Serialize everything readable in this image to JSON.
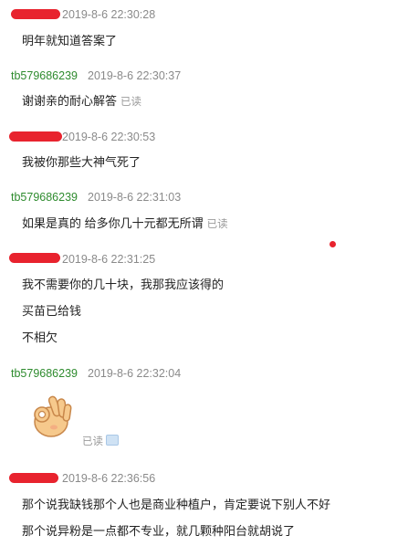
{
  "colors": {
    "nickname_seller": "#2e8b2e",
    "timestamp": "#8a8a8a",
    "redaction": "#e8232e",
    "read_status": "#9a9a9a"
  },
  "messages": [
    {
      "sender": "",
      "time": "2019-8-6 22:30:28",
      "lines": [
        "明年就知道答案了"
      ]
    },
    {
      "sender": "tb579686239",
      "time": "2019-8-6 22:30:37",
      "lines": [
        "谢谢亲的耐心解答"
      ],
      "status": "已读"
    },
    {
      "sender": "",
      "time": "2019-8-6 22:30:53",
      "lines": [
        "我被你那些大神气死了"
      ]
    },
    {
      "sender": "tb579686239",
      "time": "2019-8-6 22:31:03",
      "lines": [
        "如果是真的 给多你几十元都无所谓"
      ],
      "status": "已读"
    },
    {
      "sender": "",
      "time": "2019-8-6 22:31:25",
      "lines": [
        "我不需要你的几十块，我那我应该得的",
        "买苗已给钱",
        "不相欠"
      ]
    },
    {
      "sender": "tb579686239",
      "time": "2019-8-6 22:32:04",
      "sticker": "ok-hand-icon",
      "status": "已读"
    },
    {
      "sender": "",
      "time": "2019-8-6 22:36:56",
      "lines": [
        "那个说我缺钱那个人也是商业种植户，肯定要说下别人不好",
        "那个说异粉是一点都不专业，就几颗种阳台就胡说了"
      ]
    }
  ]
}
